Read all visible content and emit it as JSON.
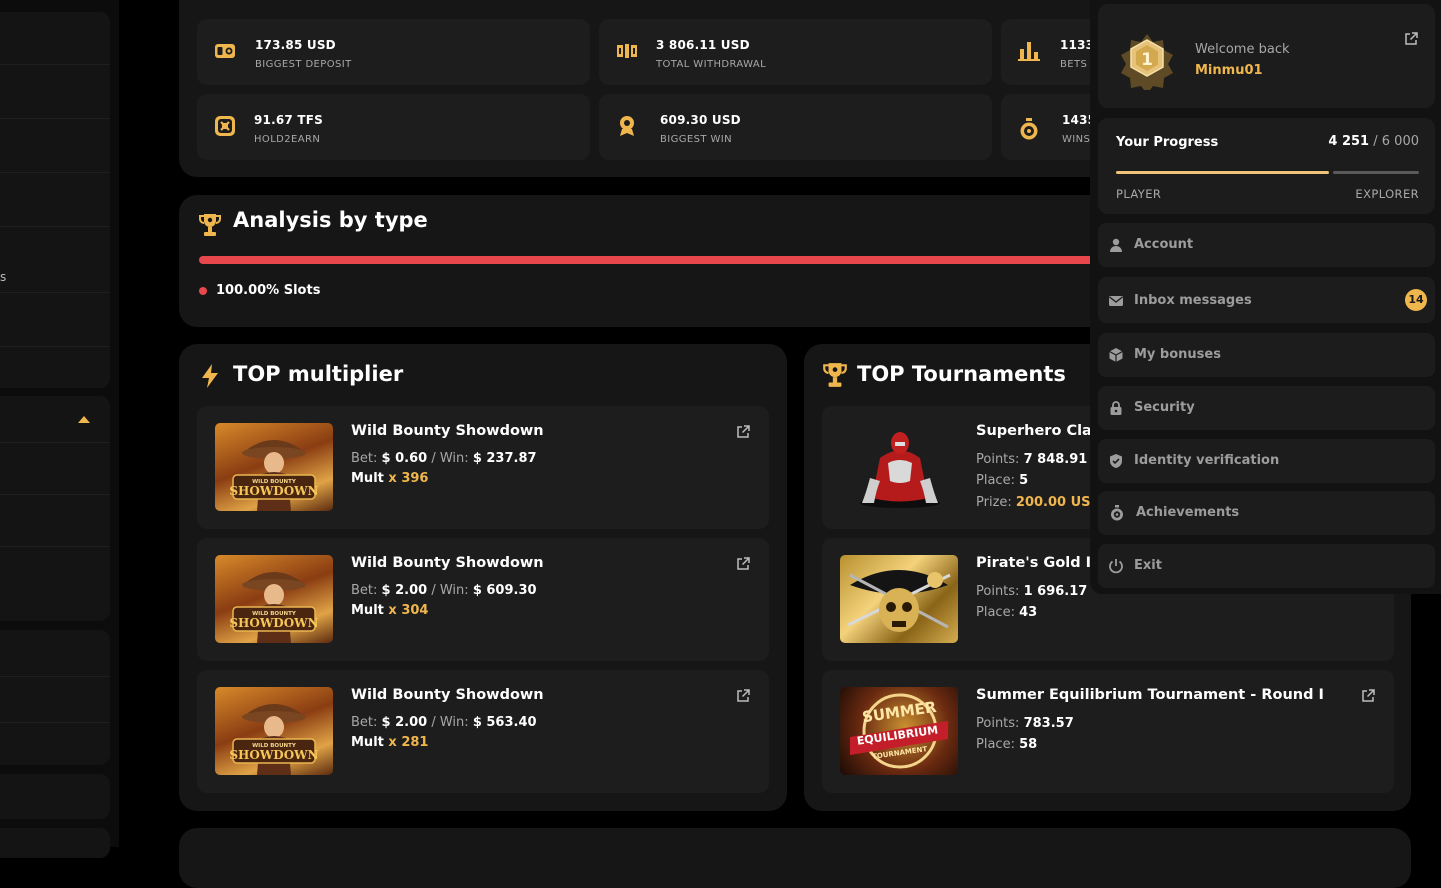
{
  "stats": [
    {
      "value": "173.85 USD",
      "label": "BIGGEST DEPOSIT",
      "icon": "wallet-icon"
    },
    {
      "value": "3 806.11 USD",
      "label": "TOTAL WITHDRAWAL",
      "icon": "withdraw-icon"
    },
    {
      "value": "1133",
      "label": "BETS",
      "icon": "bar-chart-icon"
    },
    {
      "value": "91.67 TFS",
      "label": "HOLD2EARN",
      "icon": "token-icon"
    },
    {
      "value": "609.30 USD",
      "label": "BIGGEST WIN",
      "icon": "medal-icon"
    },
    {
      "value": "1435",
      "label": "WINS",
      "icon": "stopwatch-icon"
    }
  ],
  "analysis": {
    "title": "Analysis by type",
    "legend_value": "100.00%",
    "legend_label": "Slots",
    "bar_fraction": 1.0,
    "bar_color": "#e8474c"
  },
  "top_multiplier": {
    "title": "TOP multiplier",
    "bet_label": "Bet:",
    "win_label": "Win:",
    "mult_label": "Mult",
    "items": [
      {
        "name": "Wild Bounty Showdown",
        "bet": "$ 0.60",
        "win": "$ 237.87",
        "mult": "x 396"
      },
      {
        "name": "Wild Bounty Showdown",
        "bet": "$ 2.00",
        "win": "$ 609.30",
        "mult": "x 304"
      },
      {
        "name": "Wild Bounty Showdown",
        "bet": "$ 2.00",
        "win": "$ 563.40",
        "mult": "x 281"
      }
    ],
    "thumb_text_top": "WILD BOUNTY",
    "thumb_text_main": "SHOWDOWN"
  },
  "top_tournaments": {
    "title": "TOP Tournaments",
    "points_label": "Points:",
    "place_label": "Place:",
    "prize_label": "Prize:",
    "items": [
      {
        "name": "Superhero Cla",
        "points": "7 848.91",
        "place": "5",
        "prize": "200.00 USI"
      },
      {
        "name": "Pirate's Gold I",
        "points": "1 696.17",
        "place": "43"
      },
      {
        "name": "Summer Equilibrium Tournament - Round I",
        "points": "783.57",
        "place": "58"
      }
    ],
    "summer_thumb_lines": [
      "SUMMER",
      "EQUILIBRIUM",
      "TOURNAMENT"
    ]
  },
  "user_menu": {
    "welcome": "Welcome back",
    "username": "Minmu01",
    "badge_number": "1",
    "progress_title": "Your Progress",
    "progress_current": "4 251",
    "progress_sep": "/",
    "progress_total": "6 000",
    "progress_fraction": 0.7085,
    "level_current": "PLAYER",
    "level_next": "EXPLORER",
    "items": [
      {
        "label": "Account",
        "icon": "user-icon"
      },
      {
        "label": "Inbox messages",
        "icon": "mail-icon",
        "badge": "14"
      },
      {
        "label": "My bonuses",
        "icon": "cube-icon"
      },
      {
        "label": "Security",
        "icon": "lock-icon"
      },
      {
        "label": "Identity verification",
        "icon": "shield-check-icon"
      },
      {
        "label": "Achievements",
        "icon": "medal-icon"
      },
      {
        "label": "Exit",
        "icon": "power-icon"
      }
    ]
  },
  "sidebar": {
    "partial_text": "s"
  },
  "colors": {
    "accent": "#f0b64e",
    "bar_red": "#e8474c",
    "panel": "#161616",
    "card": "#1d1d1d"
  }
}
